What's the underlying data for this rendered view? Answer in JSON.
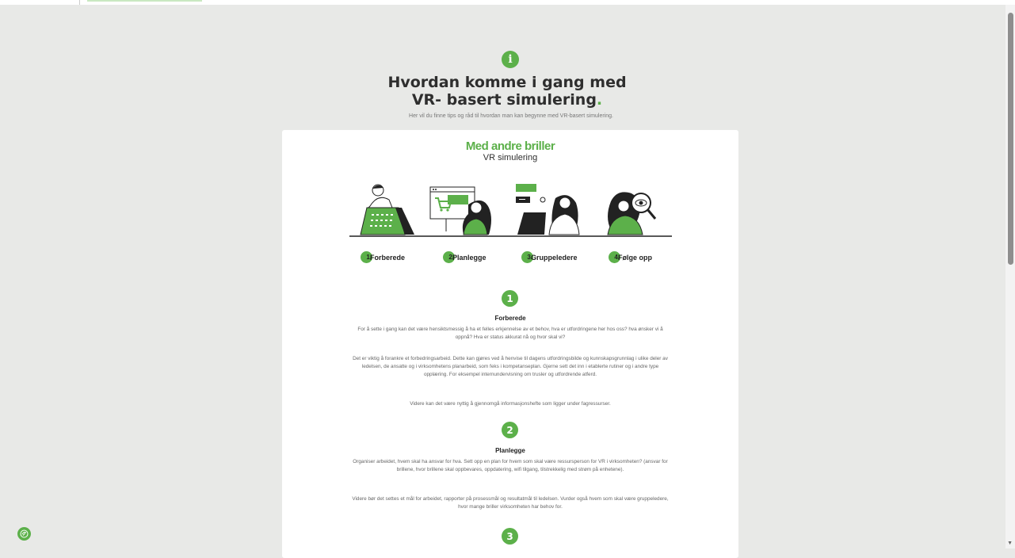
{
  "hero": {
    "title_line1": "Hvordan komme i gang med",
    "title_line2": "VR- basert simulering",
    "title_dot": ".",
    "subtitle": "Her vil du finne tips og råd til hvordan man kan begynne med VR-basert simulering."
  },
  "icons": {
    "info": "info-icon",
    "accessibility": "accessibility-icon"
  },
  "colors": {
    "accent": "#5cb04a",
    "page_bg": "#e8e9e7",
    "card_bg": "#ffffff"
  },
  "card": {
    "brand_title": "Med andre briller",
    "brand_subtitle": "VR simulering",
    "steps": [
      {
        "num": "1.",
        "label": "Forberede"
      },
      {
        "num": "2.",
        "label": "Planlegge"
      },
      {
        "num": "3.",
        "label": "Gruppeledere"
      },
      {
        "num": "4.",
        "label": "Følge opp"
      }
    ]
  },
  "sections": [
    {
      "num": "1",
      "title": "Forberede",
      "paragraphs": [
        "For å sette i gang kan det være hensiktsmessig å ha et felles erkjennelse av et behov, hva er utfordringene her hos oss? hva ønsker vi å oppnå? Hva er status akkurat nå og hvor skal vi?",
        "Det er viktig å forankre et forbedringsarbeid. Dette kan gjøres ved å henvise til dagens utfordringsbilde og kunnskapsgrunnlag i ulike deler av ledelsen, de ansatte og i virksomhetens planarbeid, som feks i kompetanseplan. Gjerne sett det inn i etablerte rutiner og i andre type opplæring. For eksempel internundervisning om trusler og utfordrende atferd.",
        "Videre kan det være nyttig å gjennomgå informasjonshefte som ligger under fagressurser."
      ]
    },
    {
      "num": "2",
      "title": "Planlegge",
      "paragraphs": [
        "Organiser arbeidet, hvem skal ha ansvar for hva. Sett opp en plan for hvem som skal være ressursperson for VR i virksomheten? (ansvar for brillene, hvor brillene skal oppbevares, oppdatering, wifi tilgang, tilstrekkelig med strøm på enhetene).",
        "Videre bør det settes et mål for arbeidet, rapporter på prosessmål og resultatmål til ledelsen. Vurder også hvem som skal være gruppeledere, hvor mange briller virksomheten har behov for."
      ]
    },
    {
      "num": "3"
    }
  ]
}
